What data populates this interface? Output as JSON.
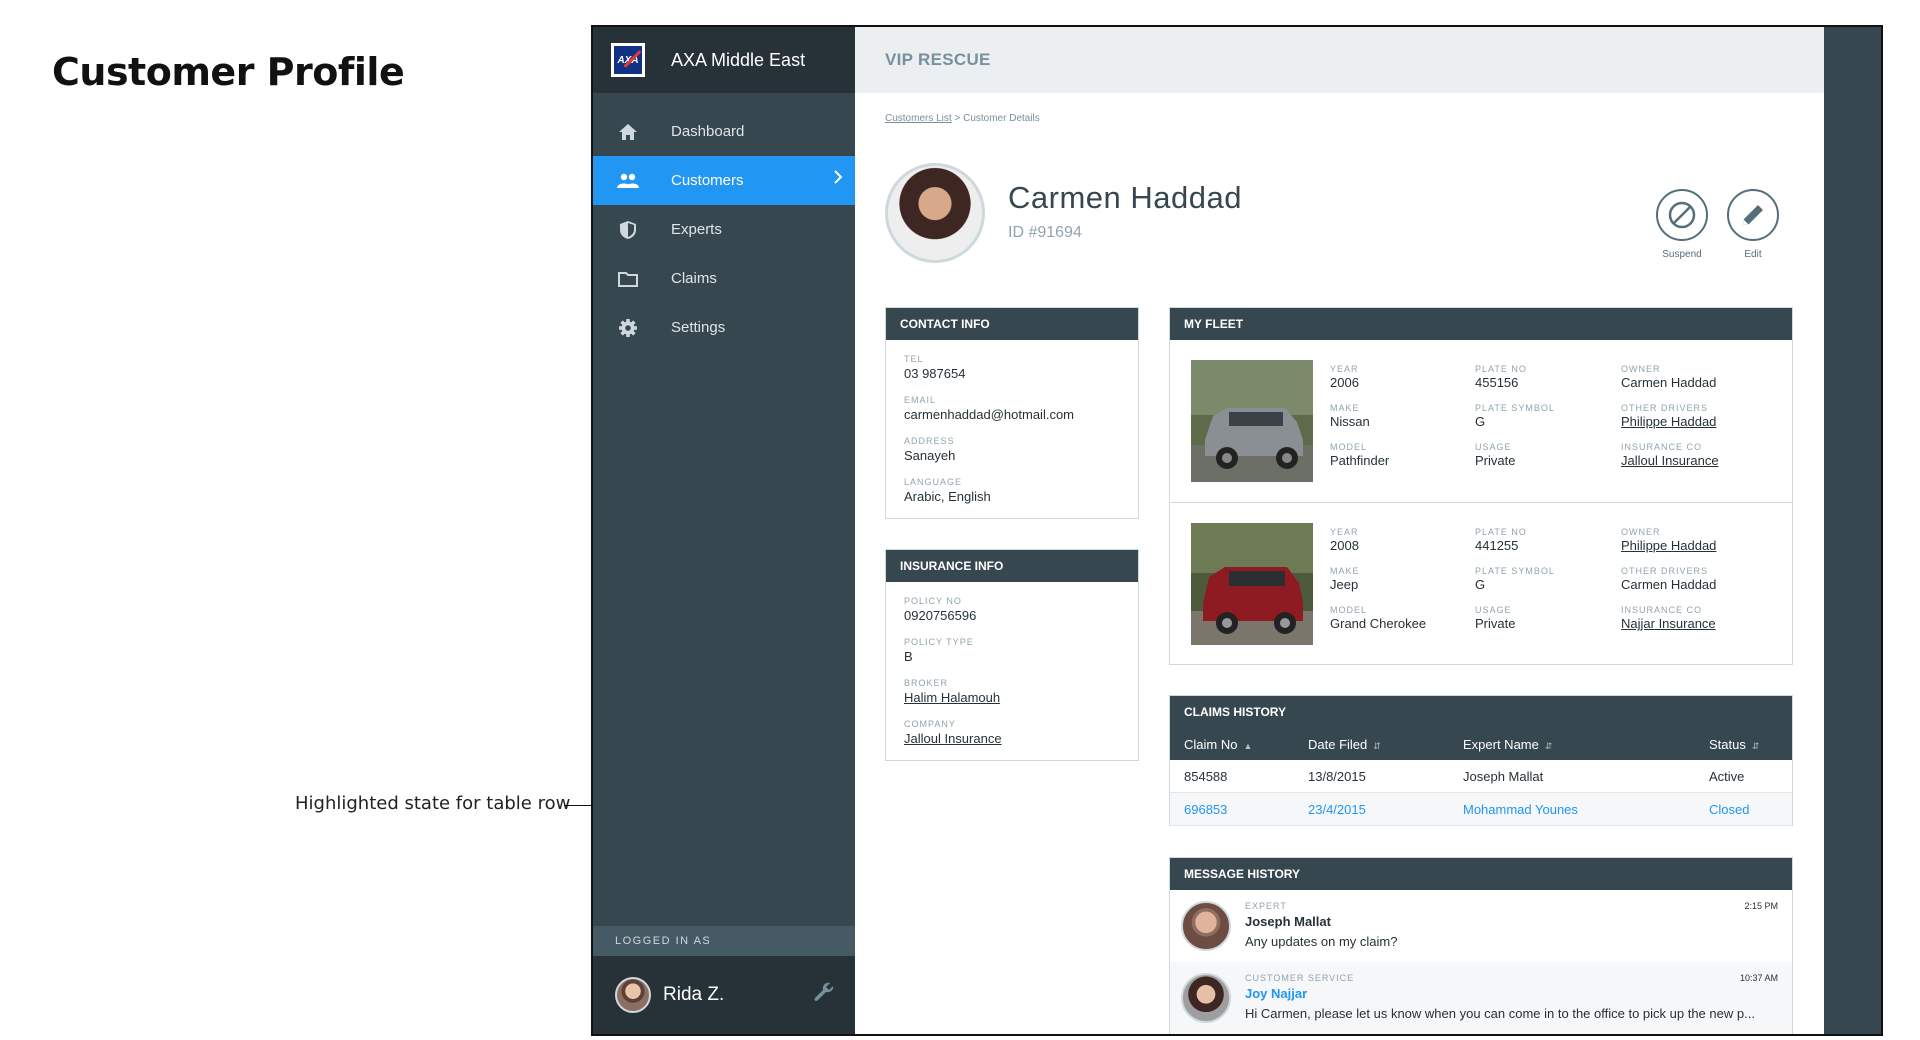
{
  "page": {
    "heading": "Customer Profile",
    "annotation": "Highlighted state for table row"
  },
  "sidebar": {
    "brand": "AXA Middle East",
    "logo_text": "AXA",
    "items": [
      {
        "label": "Dashboard",
        "icon": "home-icon"
      },
      {
        "label": "Customers",
        "icon": "people-icon",
        "active": true
      },
      {
        "label": "Experts",
        "icon": "shield-icon"
      },
      {
        "label": "Claims",
        "icon": "folder-icon"
      },
      {
        "label": "Settings",
        "icon": "gear-icon"
      }
    ],
    "logged_label": "LOGGED IN AS",
    "user_name": "Rida Z."
  },
  "topbar": {
    "title": "VIP RESCUE"
  },
  "breadcrumb": {
    "link": "Customers List",
    "separator": " > ",
    "current": "Customer Details"
  },
  "profile": {
    "name": "Carmen Haddad",
    "id": "ID #91694"
  },
  "actions": {
    "suspend": "Suspend",
    "edit": "Edit"
  },
  "contact": {
    "title": "CONTACT INFO",
    "fields": [
      {
        "label": "TEL",
        "value": "03 987654"
      },
      {
        "label": "EMAIL",
        "value": "carmenhaddad@hotmail.com"
      },
      {
        "label": "ADDRESS",
        "value": "Sanayeh"
      },
      {
        "label": "LANGUAGE",
        "value": "Arabic, English"
      }
    ]
  },
  "insurance": {
    "title": "INSURANCE INFO",
    "fields": [
      {
        "label": "POLICY NO",
        "value": "0920756596"
      },
      {
        "label": "POLICY TYPE",
        "value": "B"
      },
      {
        "label": "BROKER",
        "value": "Halim Halamouh"
      },
      {
        "label": "COMPANY",
        "value": "Jalloul Insurance"
      }
    ]
  },
  "fleet": {
    "title": "MY FLEET",
    "labels": {
      "year": "YEAR",
      "make": "MAKE",
      "model": "MODEL",
      "plate_no": "PLATE NO",
      "plate_symbol": "PLATE SYMBOL",
      "usage": "USAGE",
      "owner": "OWNER",
      "other_drivers": "OTHER DRIVERS",
      "insurance_co": "INSURANCE CO"
    },
    "vehicles": [
      {
        "year": "2006",
        "make": "Nissan",
        "model": "Pathfinder",
        "plate_no": "455156",
        "plate_symbol": "G",
        "usage": "Private",
        "owner": "Carmen Haddad",
        "other_drivers": "Philippe Haddad",
        "insurance_co": "Jalloul Insurance",
        "color": "#8a8f94"
      },
      {
        "year": "2008",
        "make": "Jeep",
        "model": "Grand Cherokee",
        "plate_no": "441255",
        "plate_symbol": "G",
        "usage": "Private",
        "owner": "Philippe Haddad",
        "other_drivers": "Carmen Haddad",
        "insurance_co": "Najjar Insurance",
        "color": "#8e1b22"
      }
    ]
  },
  "claims": {
    "title": "CLAIMS HISTORY",
    "columns": [
      "Claim No",
      "Date Filed",
      "Expert Name",
      "Status"
    ],
    "rows": [
      {
        "claim_no": "854588",
        "date": "13/8/2015",
        "expert": "Joseph Mallat",
        "status": "Active"
      },
      {
        "claim_no": "696853",
        "date": "23/4/2015",
        "expert": "Mohammad Younes",
        "status": "Closed"
      }
    ]
  },
  "messages": {
    "title": "MESSAGE HISTORY",
    "items": [
      {
        "role": "EXPERT",
        "name": "Joseph Mallat",
        "text": "Any updates on my claim?",
        "time": "2:15 PM"
      },
      {
        "role": "CUSTOMER SERVICE",
        "name": "Joy Najjar",
        "text": "Hi Carmen, please let us know when you can come in to the office to pick up the new p...",
        "time": "10:37 AM"
      }
    ]
  },
  "colors": {
    "accent": "#2196f3",
    "sidebar": "#37474f",
    "sidebar_dark": "#263238"
  }
}
